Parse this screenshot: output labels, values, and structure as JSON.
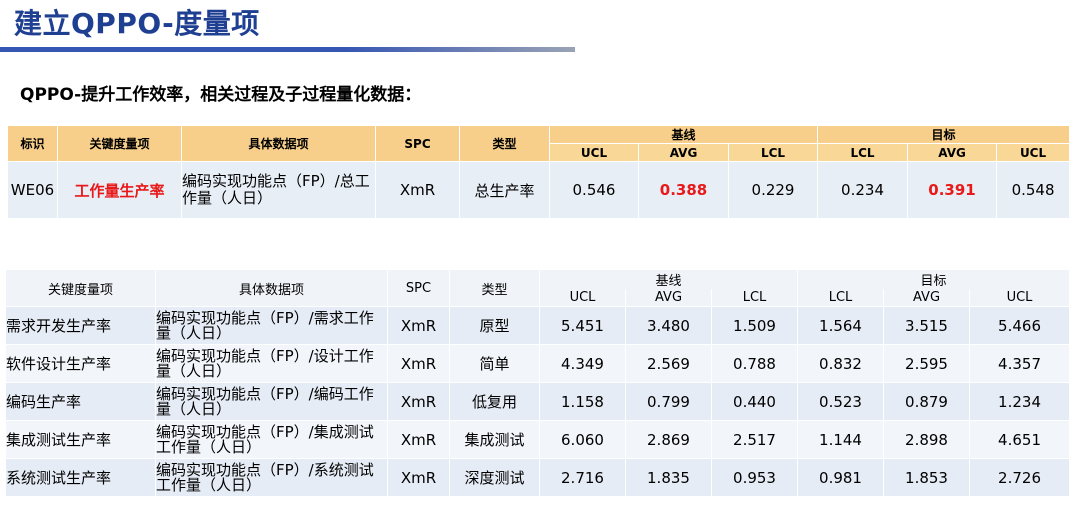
{
  "title": "建立QPPO-度量项",
  "subtitle": "QPPO-提升工作效率，相关过程及子过程量化数据：",
  "table1": {
    "headers": {
      "id": "标识",
      "metric": "关键度量项",
      "data_item": "具体数据项",
      "spc": "SPC",
      "type": "类型",
      "baseline": "基线",
      "target": "目标",
      "ucl": "UCL",
      "avg": "AVG",
      "lcl": "LCL"
    },
    "row": {
      "id": "WE06",
      "metric": "工作量生产率",
      "data_item": "编码实现功能点（FP）/总工作量（人日）",
      "spc": "XmR",
      "type": "总生产率",
      "base_ucl": "0.546",
      "base_avg": "0.388",
      "base_lcl": "0.229",
      "tgt_lcl": "0.234",
      "tgt_avg": "0.391",
      "tgt_ucl": "0.548"
    }
  },
  "table2": {
    "headers": {
      "metric": "关键度量项",
      "data_item": "具体数据项",
      "spc": "SPC",
      "type": "类型",
      "baseline": "基线",
      "target": "目标",
      "ucl": "UCL",
      "avg": "AVG",
      "lcl": "LCL"
    },
    "rows": [
      {
        "metric": "需求开发生产率",
        "data_item": "编码实现功能点（FP）/需求工作量（人日）",
        "spc": "XmR",
        "type": "原型",
        "base_ucl": "5.451",
        "base_avg": "3.480",
        "base_lcl": "1.509",
        "tgt_lcl": "1.564",
        "tgt_avg": "3.515",
        "tgt_ucl": "5.466"
      },
      {
        "metric": "软件设计生产率",
        "data_item": "编码实现功能点（FP）/设计工作量（人日）",
        "spc": "XmR",
        "type": "简单",
        "base_ucl": "4.349",
        "base_avg": "2.569",
        "base_lcl": "0.788",
        "tgt_lcl": "0.832",
        "tgt_avg": "2.595",
        "tgt_ucl": "4.357"
      },
      {
        "metric": "编码生产率",
        "data_item": "编码实现功能点（FP）/编码工作量（人日）",
        "spc": "XmR",
        "type": "低复用",
        "base_ucl": "1.158",
        "base_avg": "0.799",
        "base_lcl": "0.440",
        "tgt_lcl": "0.523",
        "tgt_avg": "0.879",
        "tgt_ucl": "1.234"
      },
      {
        "metric": "集成测试生产率",
        "data_item": "编码实现功能点（FP）/集成测试工作量（人日）",
        "spc": "XmR",
        "type": "集成测试",
        "base_ucl": "6.060",
        "base_avg": "2.869",
        "base_lcl": "2.517",
        "tgt_lcl": "1.144",
        "tgt_avg": "2.898",
        "tgt_ucl": "4.651"
      },
      {
        "metric": "系统测试生产率",
        "data_item": "编码实现功能点（FP）/系统测试工作量（人日）",
        "spc": "XmR",
        "type": "深度测试",
        "base_ucl": "2.716",
        "base_avg": "1.835",
        "base_lcl": "0.953",
        "tgt_lcl": "0.981",
        "tgt_avg": "1.853",
        "tgt_ucl": "2.726"
      }
    ]
  }
}
